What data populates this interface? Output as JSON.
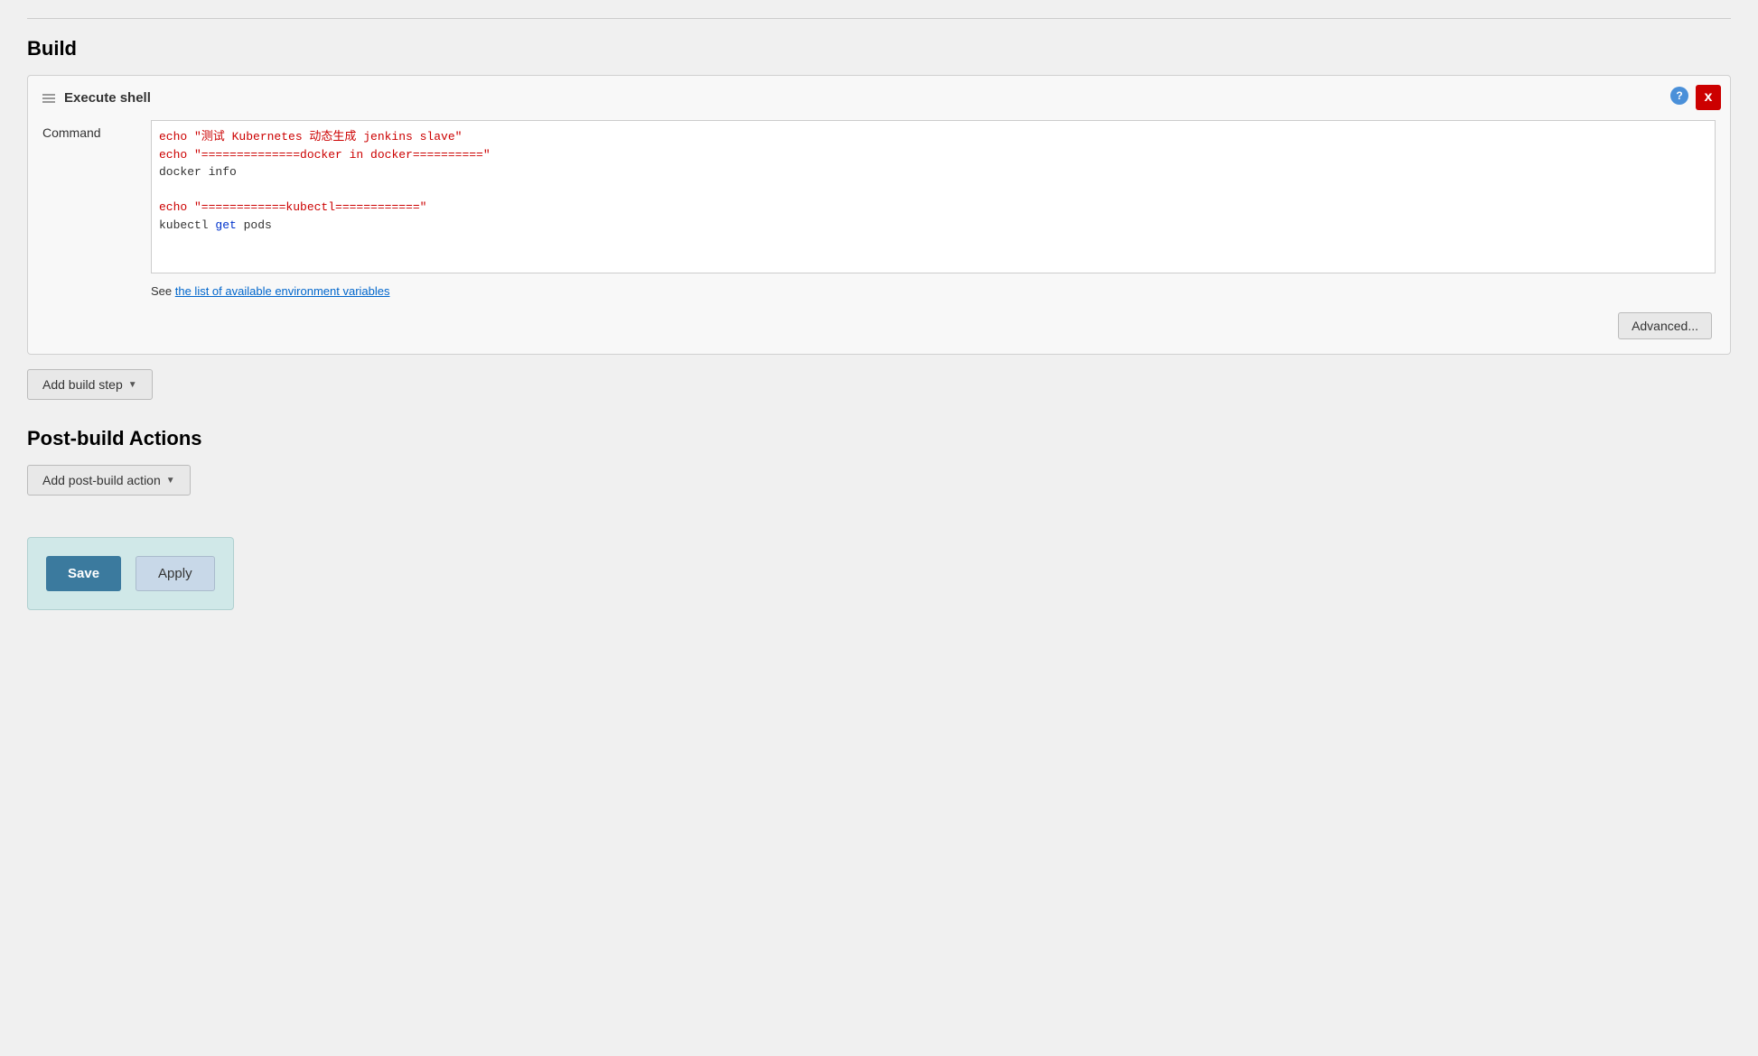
{
  "build": {
    "section_title": "Build",
    "execute_shell": {
      "title": "Execute shell",
      "close_label": "x",
      "help_label": "?",
      "command_label": "Command",
      "command_lines": [
        {
          "text": "echo \"测试 Kubernetes 动态生成 jenkins slave\"",
          "style": "red"
        },
        {
          "text": "echo \"==============docker in docker==========\"",
          "style": "red"
        },
        {
          "text": "docker info",
          "style": "normal"
        },
        {
          "text": "",
          "style": "normal"
        },
        {
          "text": "echo \"============kubectl============\"",
          "style": "red"
        },
        {
          "text": "kubectl ",
          "style": "normal"
        },
        {
          "text": "get",
          "style": "blue_inline"
        },
        {
          "text": " pods",
          "style": "normal_inline"
        }
      ],
      "see_text": "See ",
      "see_link_text": "the list of available environment variables",
      "see_link_href": "#",
      "advanced_label": "Advanced..."
    },
    "add_build_step_label": "Add build step"
  },
  "post_build": {
    "section_title": "Post-build Actions",
    "add_post_build_label": "Add post-build action"
  },
  "actions": {
    "save_label": "Save",
    "apply_label": "Apply"
  }
}
